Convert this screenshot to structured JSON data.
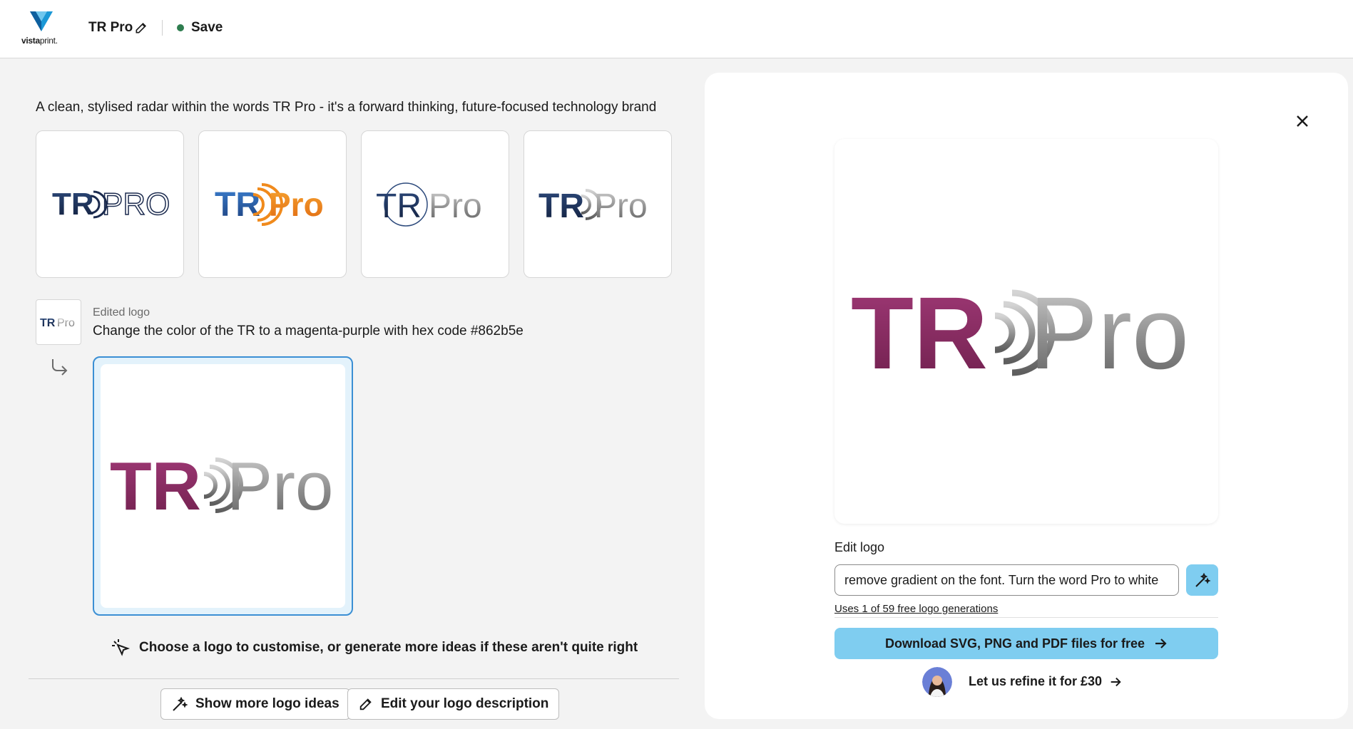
{
  "header": {
    "brand_bold": "vista",
    "brand_lite": "print.",
    "doc_title": "TR Pro",
    "save_label": "Save"
  },
  "prompt": "A clean, stylised radar within the words TR Pro - it's a forward thinking, future-focused technology brand",
  "logo_text": {
    "tr_upper": "TR",
    "pro_upper": "PRO",
    "pro": "Pro"
  },
  "edit_history": {
    "label": "Edited logo",
    "description": "Change the color of the TR to a magenta-purple with hex code #862b5e"
  },
  "hint": "Choose a logo to customise, or generate more ideas if these aren't quite right",
  "actions": {
    "show_more": "Show more logo ideas",
    "edit_description": "Edit your logo description"
  },
  "panel": {
    "edit_label": "Edit logo",
    "edit_value": "remove gradient on the font. Turn the word Pro to white",
    "uses": "Uses 1 of 59 free logo generations",
    "download": "Download SVG, PNG and PDF files for free",
    "refine": "Let us refine it for £30"
  },
  "colors": {
    "magenta": "#862b5e",
    "accent_blue": "#7fcdf0",
    "navy": "#1b2a4e",
    "orange": "#f08a1c"
  }
}
